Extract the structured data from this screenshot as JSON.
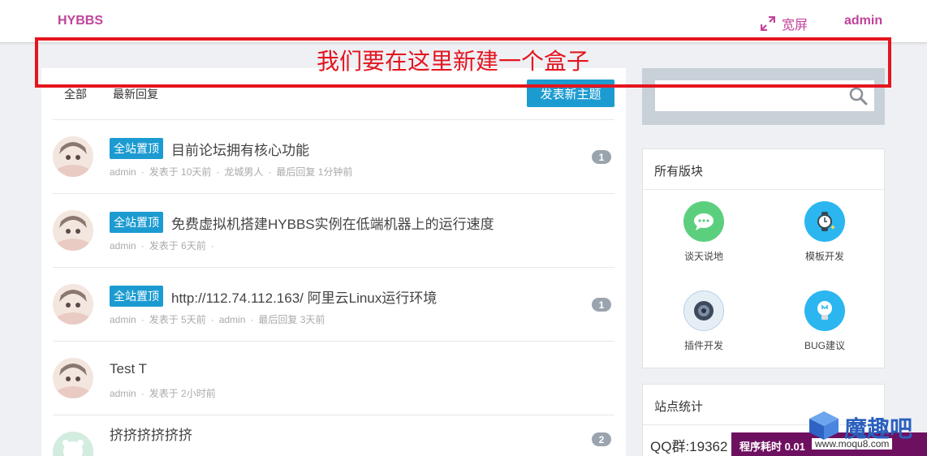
{
  "header": {
    "brand": "HYBBS",
    "wide_label": "宽屏",
    "user": "admin"
  },
  "annotation": {
    "text": "我们要在这里新建一个盒子",
    "color": "#e4151f"
  },
  "tabs": [
    {
      "label": "全部"
    },
    {
      "label": "最新回复"
    }
  ],
  "new_topic": "发表新主题",
  "threads": [
    {
      "pin": "全站置顶",
      "title": "目前论坛拥有核心功能",
      "author": "admin",
      "posted": "发表于 10天前",
      "last_user": "龙城男人",
      "last_reply": "最后回复 1分钟前",
      "replies": "1"
    },
    {
      "pin": "全站置顶",
      "title": "免费虚拟机搭建HYBBS实例在低端机器上的运行速度",
      "author": "admin",
      "posted": "发表于 6天前",
      "last_user": "",
      "last_reply": "",
      "replies": ""
    },
    {
      "pin": "全站置顶",
      "title": "http://112.74.112.163/ 阿里云Linux运行环境",
      "author": "admin",
      "posted": "发表于 5天前",
      "last_user": "admin",
      "last_reply": "最后回复 3天前",
      "replies": "1"
    },
    {
      "pin": "",
      "title": "Test T",
      "author": "admin",
      "posted": "发表于 2小时前",
      "last_user": "",
      "last_reply": "",
      "replies": ""
    },
    {
      "pin": "",
      "title": "挤挤挤挤挤挤",
      "author": "",
      "posted": "",
      "last_user": "",
      "last_reply": "",
      "replies": "2"
    }
  ],
  "forums_panel": {
    "title": "所有版块",
    "items": [
      {
        "label": "谈天说地",
        "icon": "chat-bubble-icon",
        "color": "#5ccf7e"
      },
      {
        "label": "模板开发",
        "icon": "watch-icon",
        "color": "#2bb6f0"
      },
      {
        "label": "插件开发",
        "icon": "speaker-icon",
        "color": "#e6eef5"
      },
      {
        "label": "BUG建议",
        "icon": "lightbulb-icon",
        "color": "#2bb6f0"
      }
    ]
  },
  "stats_panel": {
    "title": "站点统计",
    "qq": "QQ群:19362"
  },
  "watermark": {
    "time": "程序耗时 0.01",
    "url": "www.moqu8.com",
    "brand": "魔趣吧"
  },
  "colors": {
    "accent": "#c0439a",
    "primary": "#1c9bd1"
  }
}
